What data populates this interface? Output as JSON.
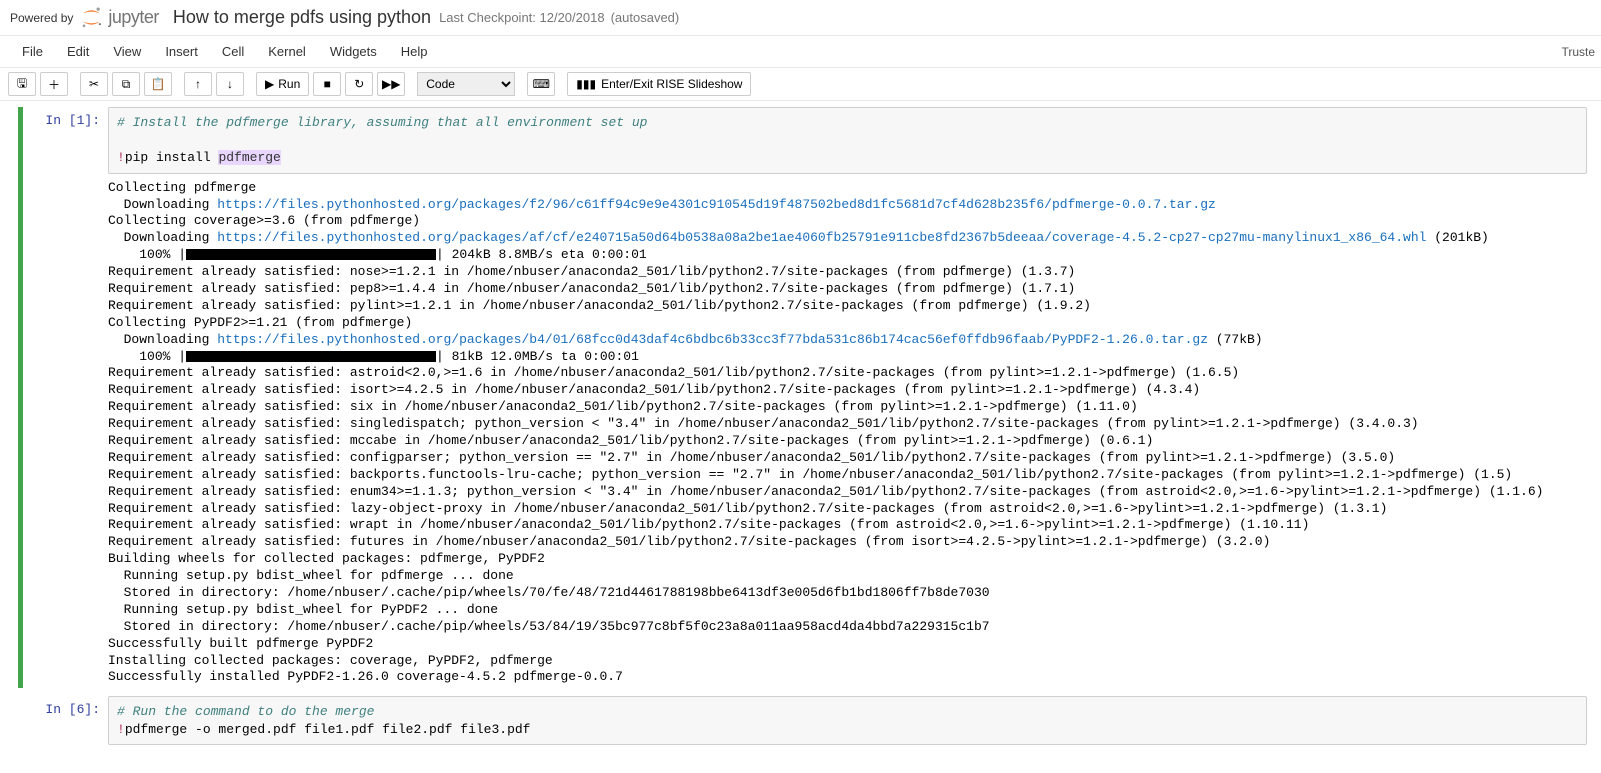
{
  "header": {
    "powered_by": "Powered by",
    "logo_text": "jupyter",
    "title": "How to merge pdfs using python",
    "checkpoint": "Last Checkpoint: 12/20/2018",
    "autosaved": "(autosaved)",
    "trusted": "Truste"
  },
  "menu": {
    "file": "File",
    "edit": "Edit",
    "view": "View",
    "insert": "Insert",
    "cell": "Cell",
    "kernel": "Kernel",
    "widgets": "Widgets",
    "help": "Help"
  },
  "toolbar": {
    "run_label": "Run",
    "celltype": "Code",
    "slideshow": "Enter/Exit RISE Slideshow"
  },
  "cells": [
    {
      "prompt": "In [1]:",
      "code_comment": "# Install the pdfmerge library, assuming that all environment set up",
      "code_bang": "!",
      "code_cmd": "pip install ",
      "code_lib": "pdfmerge",
      "output": {
        "l0": "Collecting pdfmerge",
        "l1a": "  Downloading ",
        "l1url": "https://files.pythonhosted.org/packages/f2/96/c61ff94c9e9e4301c910545d19f487502bed8d1fc5681d7cf4d628b235f6/pdfmerge-0.0.7.tar.gz",
        "l2": "Collecting coverage>=3.6 (from pdfmerge)",
        "l3a": "  Downloading ",
        "l3url": "https://files.pythonhosted.org/packages/af/cf/e240715a50d64b0538a08a2be1ae4060fb25791e911cbe8fd2367b5deeaa/coverage-4.5.2-cp27-cp27mu-manylinux1_x86_64.whl",
        "l3b": " (201kB)",
        "l4a": "    100% |",
        "l4b": "| 204kB 8.8MB/s eta 0:00:01",
        "l5": "Requirement already satisfied: nose>=1.2.1 in /home/nbuser/anaconda2_501/lib/python2.7/site-packages (from pdfmerge) (1.3.7)",
        "l6": "Requirement already satisfied: pep8>=1.4.4 in /home/nbuser/anaconda2_501/lib/python2.7/site-packages (from pdfmerge) (1.7.1)",
        "l7": "Requirement already satisfied: pylint>=1.2.1 in /home/nbuser/anaconda2_501/lib/python2.7/site-packages (from pdfmerge) (1.9.2)",
        "l8": "Collecting PyPDF2>=1.21 (from pdfmerge)",
        "l9a": "  Downloading ",
        "l9url": "https://files.pythonhosted.org/packages/b4/01/68fcc0d43daf4c6bdbc6b33cc3f77bda531c86b174cac56ef0ffdb96faab/PyPDF2-1.26.0.tar.gz",
        "l9b": " (77kB)",
        "l10a": "    100% |",
        "l10b": "| 81kB 12.0MB/s ta 0:00:01",
        "l11": "Requirement already satisfied: astroid<2.0,>=1.6 in /home/nbuser/anaconda2_501/lib/python2.7/site-packages (from pylint>=1.2.1->pdfmerge) (1.6.5)",
        "l12": "Requirement already satisfied: isort>=4.2.5 in /home/nbuser/anaconda2_501/lib/python2.7/site-packages (from pylint>=1.2.1->pdfmerge) (4.3.4)",
        "l13": "Requirement already satisfied: six in /home/nbuser/anaconda2_501/lib/python2.7/site-packages (from pylint>=1.2.1->pdfmerge) (1.11.0)",
        "l14": "Requirement already satisfied: singledispatch; python_version < \"3.4\" in /home/nbuser/anaconda2_501/lib/python2.7/site-packages (from pylint>=1.2.1->pdfmerge) (3.4.0.3)",
        "l15": "Requirement already satisfied: mccabe in /home/nbuser/anaconda2_501/lib/python2.7/site-packages (from pylint>=1.2.1->pdfmerge) (0.6.1)",
        "l16": "Requirement already satisfied: configparser; python_version == \"2.7\" in /home/nbuser/anaconda2_501/lib/python2.7/site-packages (from pylint>=1.2.1->pdfmerge) (3.5.0)",
        "l17": "Requirement already satisfied: backports.functools-lru-cache; python_version == \"2.7\" in /home/nbuser/anaconda2_501/lib/python2.7/site-packages (from pylint>=1.2.1->pdfmerge) (1.5)",
        "l18": "Requirement already satisfied: enum34>=1.1.3; python_version < \"3.4\" in /home/nbuser/anaconda2_501/lib/python2.7/site-packages (from astroid<2.0,>=1.6->pylint>=1.2.1->pdfmerge) (1.1.6)",
        "l19": "Requirement already satisfied: lazy-object-proxy in /home/nbuser/anaconda2_501/lib/python2.7/site-packages (from astroid<2.0,>=1.6->pylint>=1.2.1->pdfmerge) (1.3.1)",
        "l20": "Requirement already satisfied: wrapt in /home/nbuser/anaconda2_501/lib/python2.7/site-packages (from astroid<2.0,>=1.6->pylint>=1.2.1->pdfmerge) (1.10.11)",
        "l21": "Requirement already satisfied: futures in /home/nbuser/anaconda2_501/lib/python2.7/site-packages (from isort>=4.2.5->pylint>=1.2.1->pdfmerge) (3.2.0)",
        "l22": "Building wheels for collected packages: pdfmerge, PyPDF2",
        "l23": "  Running setup.py bdist_wheel for pdfmerge ... done",
        "l24": "  Stored in directory: /home/nbuser/.cache/pip/wheels/70/fe/48/721d4461788198bbe6413df3e005d6fb1bd1806ff7b8de7030",
        "l25": "  Running setup.py bdist_wheel for PyPDF2 ... done",
        "l26": "  Stored in directory: /home/nbuser/.cache/pip/wheels/53/84/19/35bc977c8bf5f0c23a8a011aa958acd4da4bbd7a229315c1b7",
        "l27": "Successfully built pdfmerge PyPDF2",
        "l28": "Installing collected packages: coverage, PyPDF2, pdfmerge",
        "l29": "Successfully installed PyPDF2-1.26.0 coverage-4.5.2 pdfmerge-0.0.7"
      }
    },
    {
      "prompt": "In [6]:",
      "code_comment": "# Run the command to do the merge",
      "code_bang": "!",
      "code_cmd": "pdfmerge -o merged.pdf file1.pdf file2.pdf file3.pdf"
    }
  ]
}
